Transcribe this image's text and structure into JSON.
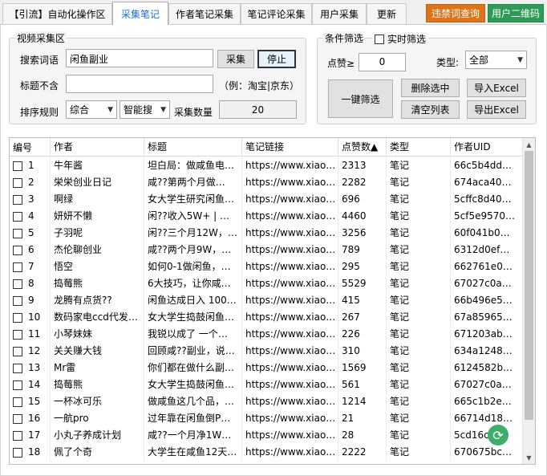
{
  "tabs": [
    {
      "label": "【引流】自动化操作区",
      "active": false
    },
    {
      "label": "采集笔记",
      "active": true
    },
    {
      "label": "作者笔记采集",
      "active": false
    },
    {
      "label": "笔记评论采集",
      "active": false
    },
    {
      "label": "用户采集",
      "active": false
    },
    {
      "label": "更新",
      "active": false
    }
  ],
  "top_buttons": {
    "banned_words": "违禁词查询",
    "banned_words_color": "#e0731a",
    "qr_code": "用户二维码",
    "qr_code_color": "#2f9a56"
  },
  "collect": {
    "group_title": "视频采集区",
    "keyword_label": "搜索词语",
    "keyword_value": "闲鱼副业",
    "collect_button": "采集",
    "stop_button": "停止",
    "exclude_label": "标题不含",
    "exclude_value": "",
    "exclude_hint": "（例：淘宝|京东）",
    "sort_label": "排序规则",
    "sort_value": "综合",
    "search_mode_value": "智能搜",
    "count_label": "采集数量",
    "count_value": "20"
  },
  "filter": {
    "group_title": "条件筛选",
    "realtime_label": "实时筛选",
    "likes_label": "点赞≥",
    "likes_value": "0",
    "type_label": "类型:",
    "type_value": "全部",
    "one_click_button": "一键筛选",
    "delete_selected_button": "删除选中",
    "import_excel_button": "导入Excel",
    "clear_list_button": "清空列表",
    "export_excel_button": "导出Excel"
  },
  "table": {
    "columns": [
      "编号",
      "作者",
      "标题",
      "笔记链接",
      "点赞数▲",
      "类型",
      "作者UID"
    ],
    "rows": [
      {
        "num": "1",
        "author": "牛年酱",
        "title": "坦白局：做咸鱼电…",
        "link": "https://www.xiao…",
        "likes": "2313",
        "type": "笔记",
        "uid": "66c5b4dd…"
      },
      {
        "num": "2",
        "author": "栄栄创业日记",
        "title": "咸??第两个月做…",
        "link": "https://www.xiao…",
        "likes": "2282",
        "type": "笔记",
        "uid": "674aca40…"
      },
      {
        "num": "3",
        "author": "啊绿",
        "title": "女大学生研究闲鱼…",
        "link": "https://www.xiao…",
        "likes": "696",
        "type": "笔记",
        "uid": "5cffc8d40…"
      },
      {
        "num": "4",
        "author": "妍妍不懒",
        "title": "闲??收入5W+ | …",
        "link": "https://www.xiao…",
        "likes": "4460",
        "type": "笔记",
        "uid": "5cf5e9570…"
      },
      {
        "num": "5",
        "author": "子羽呢",
        "title": "闲??三个月12W，…",
        "link": "https://www.xiao…",
        "likes": "3256",
        "type": "笔记",
        "uid": "60f041b0…"
      },
      {
        "num": "6",
        "author": "杰伦聊创业",
        "title": "咸??两个月9W，…",
        "link": "https://www.xiao…",
        "likes": "789",
        "type": "笔记",
        "uid": "6312d0ef…"
      },
      {
        "num": "7",
        "author": "悟空",
        "title": "如何0-1做闲鱼，…",
        "link": "https://www.xiao…",
        "likes": "295",
        "type": "笔记",
        "uid": "662761e0…"
      },
      {
        "num": "8",
        "author": "捣莓熊",
        "title": "6大技巧，让你咸…",
        "link": "https://www.xiao…",
        "likes": "5529",
        "type": "笔记",
        "uid": "67027c0a…"
      },
      {
        "num": "9",
        "author": "龙腾有点货??",
        "title": "闲鱼达成日入 100…",
        "link": "https://www.xiao…",
        "likes": "415",
        "type": "笔记",
        "uid": "66b496e5…"
      },
      {
        "num": "10",
        "author": "数码家电ccd代发…",
        "title": "女大学生捣鼓闲鱼…",
        "link": "https://www.xiao…",
        "likes": "267",
        "type": "笔记",
        "uid": "67a85965…"
      },
      {
        "num": "11",
        "author": "小琴妹妹",
        "title": "我锐以成了 一个…",
        "link": "https://www.xiao…",
        "likes": "226",
        "type": "笔记",
        "uid": "671203ab…"
      },
      {
        "num": "12",
        "author": "关关赚大钱",
        "title": "回顾咸??副业，说…",
        "link": "https://www.xiao…",
        "likes": "310",
        "type": "笔记",
        "uid": "634a1248…"
      },
      {
        "num": "13",
        "author": "Mr雷",
        "title": "你们都在做什么副…",
        "link": "https://www.xiao…",
        "likes": "1569",
        "type": "笔记",
        "uid": "6124582b…"
      },
      {
        "num": "14",
        "author": "捣莓熊",
        "title": "女大学生捣鼓闲鱼…",
        "link": "https://www.xiao…",
        "likes": "561",
        "type": "笔记",
        "uid": "67027c0a…"
      },
      {
        "num": "15",
        "author": "一杯冰可乐",
        "title": "做咸鱼这几个品，…",
        "link": "https://www.xiao…",
        "likes": "1214",
        "type": "笔记",
        "uid": "665c1b2e…"
      },
      {
        "num": "16",
        "author": "一航pro",
        "title": "过年靠在闲鱼倒P…",
        "link": "https://www.xiao…",
        "likes": "21",
        "type": "笔记",
        "uid": "66714d18…"
      },
      {
        "num": "17",
        "author": "小丸子养成计划",
        "title": "咸??一个月净1W…",
        "link": "https://www.xiao…",
        "likes": "28",
        "type": "笔记",
        "uid": "5cd16c…"
      },
      {
        "num": "18",
        "author": "佩了个奇",
        "title": "大学生在咸鱼12天…",
        "link": "https://www.xiao…",
        "likes": "2222",
        "type": "笔记",
        "uid": "670675bc…"
      }
    ]
  }
}
